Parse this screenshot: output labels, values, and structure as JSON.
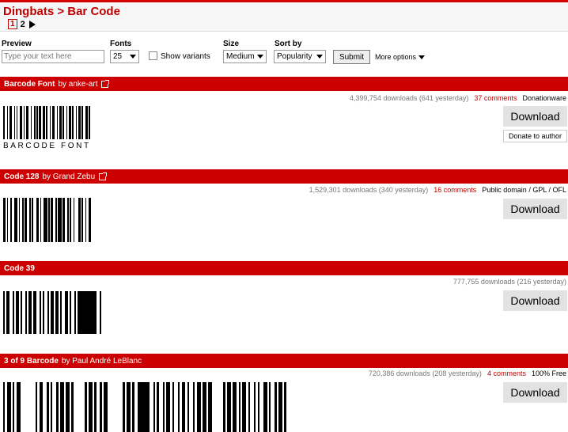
{
  "breadcrumb": "Dingbats > Bar Code",
  "pager": {
    "current": "1",
    "next_page": "2"
  },
  "controls": {
    "preview_label": "Preview",
    "preview_placeholder": "Type your text here",
    "fonts_label": "Fonts",
    "fonts_value": "25",
    "show_variants_label": "Show variants",
    "size_label": "Size",
    "size_value": "Medium",
    "sort_label": "Sort by",
    "sort_value": "Popularity",
    "submit_label": "Submit",
    "more_options_label": "More options"
  },
  "fonts": [
    {
      "name": "Barcode Font",
      "by": "by anke-art",
      "downloads": "4,399,754 downloads (641 yesterday)",
      "comments": "37 comments",
      "license": "Donationware",
      "download_label": "Download",
      "donate_label": "Donate to author",
      "sample_text": "BARCODE FONT"
    },
    {
      "name": "Code 128",
      "by": "by Grand Zebu",
      "downloads": "1,529,301 downloads (340 yesterday)",
      "comments": "16 comments",
      "license": "Public domain / GPL / OFL",
      "download_label": "Download"
    },
    {
      "name": "Code 39",
      "by": "",
      "downloads": "777,755 downloads (216 yesterday)",
      "comments": "",
      "license": "",
      "download_label": "Download"
    },
    {
      "name": "3 of 9 Barcode",
      "by": "by Paul André LeBlanc",
      "downloads": "720,386 downloads (208 yesterday)",
      "comments": "4 comments",
      "license": "100% Free",
      "download_label": "Download"
    }
  ],
  "colors": {
    "brand_red": "#cc0000",
    "comment_red": "#c00000"
  }
}
